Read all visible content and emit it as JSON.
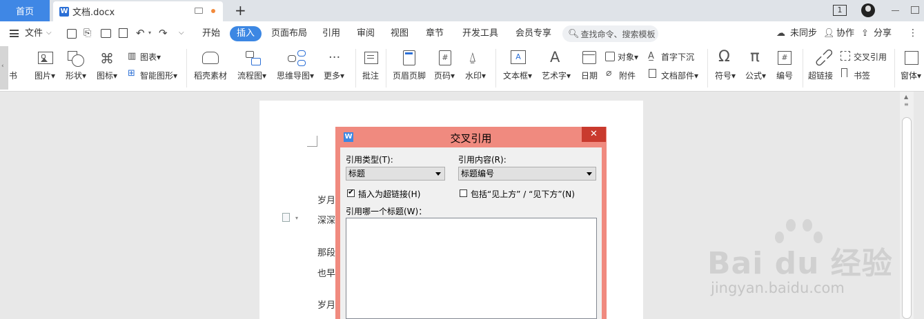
{
  "tabs": {
    "home": "首页",
    "doc_title": "文档.docx",
    "add": "+",
    "page_count": "1"
  },
  "menu": {
    "file": "文件",
    "items": [
      "开始",
      "插入",
      "页面布局",
      "引用",
      "审阅",
      "视图",
      "章节",
      "开发工具",
      "会员专享"
    ],
    "search_placeholder": "查找命令、搜索模板",
    "right": {
      "sync": "未同步",
      "collab": "协作",
      "share": "分享"
    }
  },
  "ribbon": {
    "left_partial": "书",
    "picture": "图片",
    "shape": "形状",
    "icon": "图标",
    "chart": "图表",
    "smart_art": "智能图形",
    "docer": "稻壳素材",
    "flowchart": "流程图",
    "mindmap": "思维导图",
    "more": "更多",
    "comment": "批注",
    "header_footer": "页眉页脚",
    "page_num": "页码",
    "watermark": "水印",
    "textbox": "文本框",
    "wordart": "艺术字",
    "date": "日期",
    "object": "对象",
    "attachment": "附件",
    "dropcap": "首字下沉",
    "doc_parts": "文档部件",
    "symbol": "符号",
    "formula": "公式",
    "numbering": "编号",
    "hyperlink": "超链接",
    "crossref": "交叉引用",
    "bookmark": "书签",
    "window": "窗体"
  },
  "doc": {
    "lines": [
      "岁月",
      "深深",
      "那段",
      "也早",
      "岁月"
    ]
  },
  "dialog": {
    "title": "交叉引用",
    "ref_type_label": "引用类型(T):",
    "ref_type_value": "标题",
    "ref_content_label": "引用内容(R):",
    "ref_content_value": "标题编号",
    "insert_hyperlink": "插入为超链接(H)",
    "insert_hyperlink_checked": true,
    "include_above_below": "包括“见上方” / “见下方”(N)",
    "include_above_below_checked": false,
    "which_heading_label": "引用哪一个标题(W)："
  },
  "watermark": {
    "brand": "Bai du 经验",
    "url": "jingyan.baidu.com"
  }
}
